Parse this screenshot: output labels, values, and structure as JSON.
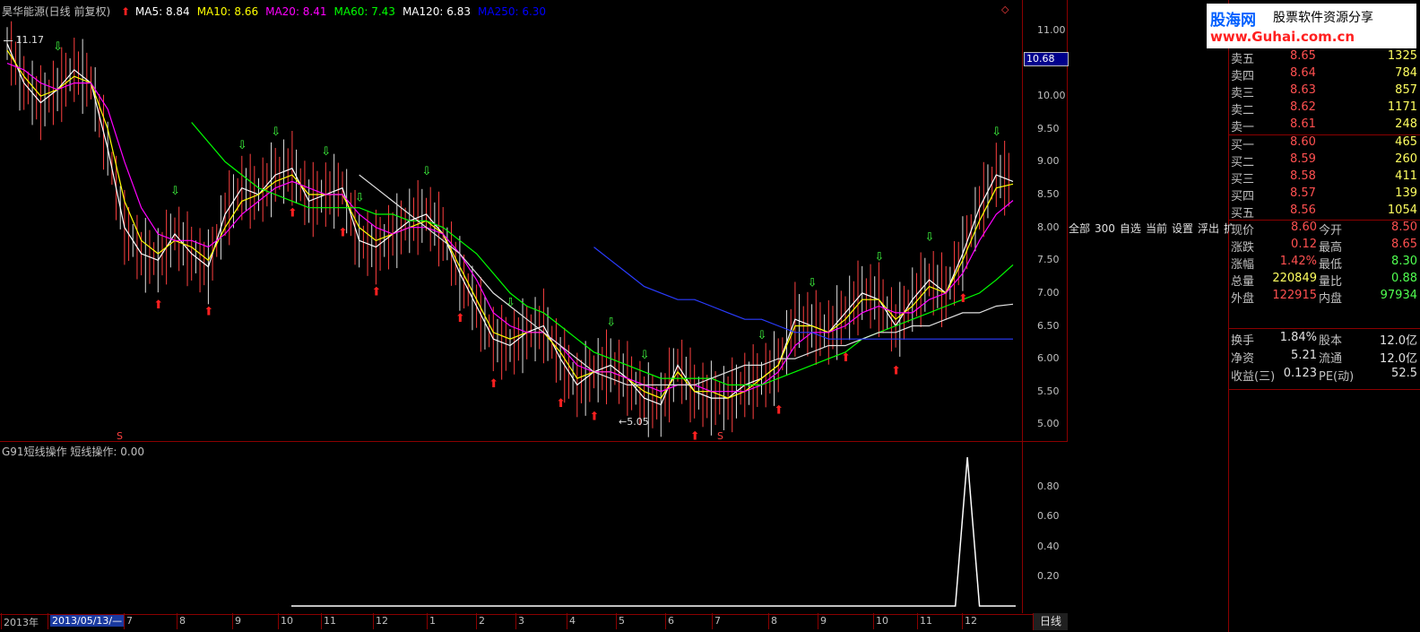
{
  "header": {
    "stock": "昊华能源(日线 前复权)",
    "ma_items": [
      {
        "label": "MA5: 8.84",
        "color": "#ffffff"
      },
      {
        "label": "MA10: 8.66",
        "color": "#ffff00"
      },
      {
        "label": "MA20: 8.41",
        "color": "#ff00ff"
      },
      {
        "label": "MA60: 7.43",
        "color": "#00ff00"
      },
      {
        "label": "MA120: 6.83",
        "color": "#ffffff"
      },
      {
        "label": "MA250: 6.30",
        "color": "#0000ff"
      }
    ]
  },
  "indicator": {
    "title": "G91短线操作  短线操作: 0.00"
  },
  "logo": {
    "text1": "股海网",
    "text2": "股票软件资源分享",
    "url": "www.Guhai.com.cn"
  },
  "order_book": {
    "asks": [
      {
        "label": "卖五",
        "price": "8.65",
        "vol": "1325"
      },
      {
        "label": "卖四",
        "price": "8.64",
        "vol": "784"
      },
      {
        "label": "卖三",
        "price": "8.63",
        "vol": "857"
      },
      {
        "label": "卖二",
        "price": "8.62",
        "vol": "1171"
      },
      {
        "label": "卖一",
        "price": "8.61",
        "vol": "248"
      }
    ],
    "bids": [
      {
        "label": "买一",
        "price": "8.60",
        "vol": "465"
      },
      {
        "label": "买二",
        "price": "8.59",
        "vol": "260"
      },
      {
        "label": "买三",
        "price": "8.58",
        "vol": "411"
      },
      {
        "label": "买四",
        "price": "8.57",
        "vol": "139"
      },
      {
        "label": "买五",
        "price": "8.56",
        "vol": "1054"
      }
    ]
  },
  "quote": [
    {
      "l1": "现价",
      "v1": "8.60",
      "c1": "#ff5050",
      "l2": "今开",
      "v2": "8.50",
      "c2": "#ff5050"
    },
    {
      "l1": "涨跌",
      "v1": "0.12",
      "c1": "#ff5050",
      "l2": "最高",
      "v2": "8.65",
      "c2": "#ff5050"
    },
    {
      "l1": "涨幅",
      "v1": "1.42%",
      "c1": "#ff5050",
      "l2": "最低",
      "v2": "8.30",
      "c2": "#50ff50"
    },
    {
      "l1": "总量",
      "v1": "220849",
      "c1": "#ffff60",
      "l2": "量比",
      "v2": "0.88",
      "c2": "#50ff50"
    },
    {
      "l1": "外盘",
      "v1": "122915",
      "c1": "#ff5050",
      "l2": "内盘",
      "v2": "97934",
      "c2": "#50ff50"
    }
  ],
  "finance": [
    {
      "l1": "换手",
      "v1": "1.84%",
      "l2": "股本",
      "v2": "12.0亿"
    },
    {
      "l1": "净资",
      "v1": "5.21",
      "l2": "流通",
      "v2": "12.0亿"
    },
    {
      "l1": "收益(三)",
      "v1": "0.123",
      "l2": "PE(动)",
      "v2": "52.5"
    }
  ],
  "tabs": [
    "全部",
    "300",
    "自选",
    "当前",
    "设置",
    "浮出",
    "扩"
  ],
  "bottom_tab": "日线",
  "current_price_box": "10.68",
  "chart_data": [
    {
      "type": "line",
      "title": "昊华能源(日线 前复权)",
      "ylim": [
        4.8,
        11.3
      ],
      "y_ticks": [
        "11.00",
        "10.50",
        "10.00",
        "9.50",
        "9.00",
        "8.50",
        "8.00",
        "7.50",
        "7.00",
        "6.50",
        "6.00",
        "5.50",
        "5.00"
      ],
      "annotations": [
        "11.17",
        "5.05"
      ],
      "x_ticks": [
        "2013年",
        "2013/05/13/—",
        "7",
        "8",
        "9",
        "10",
        "11",
        "12",
        "1",
        "2",
        "3",
        "4",
        "5",
        "6",
        "7",
        "8",
        "9",
        "10",
        "11",
        "12"
      ],
      "series": [
        {
          "name": "MA5",
          "color": "#ffffff",
          "values": [
            10.8,
            10.2,
            9.9,
            10.1,
            10.4,
            10.2,
            9.2,
            8.0,
            7.6,
            7.5,
            7.9,
            7.6,
            7.4,
            8.2,
            8.6,
            8.5,
            8.8,
            8.9,
            8.4,
            8.5,
            8.6,
            7.8,
            7.7,
            7.9,
            8.1,
            8.2,
            7.9,
            7.3,
            6.8,
            6.3,
            6.2,
            6.4,
            6.5,
            6.0,
            5.6,
            5.8,
            5.9,
            5.7,
            5.4,
            5.3,
            5.9,
            5.5,
            5.4,
            5.4,
            5.6,
            5.7,
            5.9,
            6.6,
            6.5,
            6.4,
            6.7,
            7.0,
            6.9,
            6.5,
            6.9,
            7.2,
            7.0,
            7.6,
            8.3,
            8.8,
            8.7
          ]
        },
        {
          "name": "MA10",
          "color": "#ffff00",
          "values": [
            10.7,
            10.3,
            10.0,
            10.1,
            10.3,
            10.2,
            9.5,
            8.4,
            7.8,
            7.6,
            7.8,
            7.7,
            7.5,
            8.0,
            8.4,
            8.5,
            8.7,
            8.8,
            8.5,
            8.5,
            8.5,
            8.0,
            7.8,
            7.9,
            8.0,
            8.1,
            7.9,
            7.4,
            6.9,
            6.4,
            6.3,
            6.4,
            6.4,
            6.1,
            5.7,
            5.8,
            5.8,
            5.7,
            5.5,
            5.4,
            5.8,
            5.5,
            5.5,
            5.4,
            5.5,
            5.7,
            5.9,
            6.5,
            6.5,
            6.4,
            6.6,
            6.9,
            6.9,
            6.6,
            6.8,
            7.1,
            7.0,
            7.5,
            8.1,
            8.6,
            8.66
          ]
        },
        {
          "name": "MA20",
          "color": "#ff00ff",
          "values": [
            10.5,
            10.4,
            10.2,
            10.1,
            10.2,
            10.2,
            9.8,
            9.0,
            8.3,
            7.9,
            7.8,
            7.8,
            7.7,
            7.9,
            8.2,
            8.4,
            8.6,
            8.7,
            8.6,
            8.5,
            8.5,
            8.2,
            8.0,
            7.9,
            8.0,
            8.0,
            7.9,
            7.6,
            7.2,
            6.7,
            6.5,
            6.4,
            6.4,
            6.2,
            5.9,
            5.8,
            5.8,
            5.7,
            5.6,
            5.5,
            5.6,
            5.6,
            5.5,
            5.5,
            5.5,
            5.6,
            5.8,
            6.2,
            6.4,
            6.4,
            6.5,
            6.7,
            6.8,
            6.7,
            6.7,
            6.9,
            7.0,
            7.3,
            7.8,
            8.2,
            8.41
          ]
        },
        {
          "name": "MA60",
          "color": "#00ff00",
          "values": [
            null,
            null,
            null,
            null,
            null,
            null,
            null,
            null,
            null,
            null,
            null,
            9.6,
            9.3,
            9.0,
            8.8,
            8.6,
            8.5,
            8.4,
            8.3,
            8.3,
            8.3,
            8.3,
            8.2,
            8.2,
            8.1,
            8.1,
            8.0,
            7.8,
            7.6,
            7.3,
            7.0,
            6.8,
            6.7,
            6.5,
            6.3,
            6.1,
            6.0,
            5.9,
            5.8,
            5.7,
            5.7,
            5.7,
            5.7,
            5.6,
            5.6,
            5.6,
            5.7,
            5.8,
            5.9,
            6.0,
            6.1,
            6.3,
            6.4,
            6.5,
            6.6,
            6.7,
            6.8,
            6.9,
            7.0,
            7.2,
            7.43
          ]
        },
        {
          "name": "MA120",
          "color": "#e0e0e0",
          "values": [
            null,
            null,
            null,
            null,
            null,
            null,
            null,
            null,
            null,
            null,
            null,
            null,
            null,
            null,
            null,
            null,
            null,
            null,
            null,
            null,
            null,
            8.8,
            8.6,
            8.4,
            8.2,
            8.0,
            7.8,
            7.6,
            7.3,
            7.0,
            6.8,
            6.6,
            6.4,
            6.2,
            6.0,
            5.8,
            5.7,
            5.6,
            5.6,
            5.6,
            5.6,
            5.6,
            5.7,
            5.8,
            5.9,
            5.9,
            6.0,
            6.0,
            6.1,
            6.2,
            6.2,
            6.3,
            6.4,
            6.4,
            6.5,
            6.5,
            6.6,
            6.7,
            6.7,
            6.8,
            6.83
          ]
        },
        {
          "name": "MA250",
          "color": "#2a3cff",
          "values": [
            null,
            null,
            null,
            null,
            null,
            null,
            null,
            null,
            null,
            null,
            null,
            null,
            null,
            null,
            null,
            null,
            null,
            null,
            null,
            null,
            null,
            null,
            null,
            null,
            null,
            null,
            null,
            null,
            null,
            null,
            null,
            null,
            null,
            null,
            null,
            7.7,
            7.5,
            7.3,
            7.1,
            7.0,
            6.9,
            6.9,
            6.8,
            6.7,
            6.6,
            6.6,
            6.5,
            6.4,
            6.4,
            6.3,
            6.3,
            6.3,
            6.3,
            6.3,
            6.3,
            6.3,
            6.3,
            6.3,
            6.3,
            6.3,
            6.3
          ]
        }
      ]
    },
    {
      "type": "line",
      "title": "G91短线操作",
      "ylim": [
        0,
        1
      ],
      "y_ticks": [
        "0.80",
        "0.60",
        "0.40",
        "0.20"
      ],
      "series": [
        {
          "name": "短线操作",
          "color": "#ffffff",
          "values": [
            0,
            0,
            0,
            0,
            0,
            0,
            0,
            0,
            0,
            0,
            0,
            0,
            0,
            0,
            0,
            0,
            0,
            0,
            0,
            0,
            0,
            0,
            0,
            0,
            0,
            0,
            0,
            0,
            0,
            0,
            0,
            0,
            0,
            0,
            0,
            0,
            0,
            0,
            0,
            0,
            0,
            0,
            0,
            0,
            0,
            0,
            0,
            0,
            0,
            0,
            0,
            0,
            0,
            0,
            0,
            0,
            1,
            0,
            0,
            0,
            0
          ]
        }
      ]
    }
  ]
}
